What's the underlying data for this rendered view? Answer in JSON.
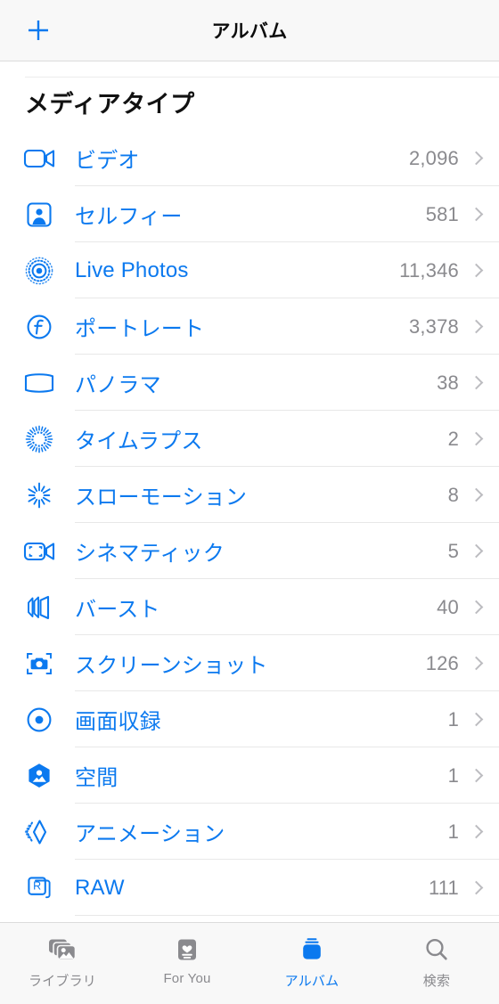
{
  "colors": {
    "accent": "#0b79ef",
    "label_gray": "#8a8a8e",
    "chevron_gray": "#bcbcc0",
    "separator": "#e8e8e8",
    "bar_background": "#f8f8f8"
  },
  "navbar": {
    "add_label": "+",
    "title": "アルバム"
  },
  "section": {
    "title": "メディアタイプ"
  },
  "rows": [
    {
      "icon": "video-icon",
      "label": "ビデオ",
      "count": "2,096"
    },
    {
      "icon": "selfies-icon",
      "label": "セルフィー",
      "count": "581"
    },
    {
      "icon": "live-photos-icon",
      "label": "Live Photos",
      "count": "11,346"
    },
    {
      "icon": "portrait-icon",
      "label": "ポートレート",
      "count": "3,378"
    },
    {
      "icon": "panorama-icon",
      "label": "パノラマ",
      "count": "38"
    },
    {
      "icon": "timelapse-icon",
      "label": "タイムラプス",
      "count": "2"
    },
    {
      "icon": "slomo-icon",
      "label": "スローモーション",
      "count": "8"
    },
    {
      "icon": "cinematic-icon",
      "label": "シネマティック",
      "count": "5"
    },
    {
      "icon": "burst-icon",
      "label": "バースト",
      "count": "40"
    },
    {
      "icon": "screenshot-icon",
      "label": "スクリーンショット",
      "count": "126"
    },
    {
      "icon": "screenrecord-icon",
      "label": "画面収録",
      "count": "1"
    },
    {
      "icon": "spatial-icon",
      "label": "空間",
      "count": "1"
    },
    {
      "icon": "animation-icon",
      "label": "アニメーション",
      "count": "1"
    },
    {
      "icon": "raw-icon",
      "label": "RAW",
      "count": "111"
    }
  ],
  "tabbar": {
    "items": [
      {
        "icon": "library-icon",
        "label": "ライブラリ",
        "active": false
      },
      {
        "icon": "foryou-icon",
        "label": "For You",
        "active": false
      },
      {
        "icon": "albums-icon",
        "label": "アルバム",
        "active": true
      },
      {
        "icon": "search-icon",
        "label": "検索",
        "active": false
      }
    ]
  }
}
